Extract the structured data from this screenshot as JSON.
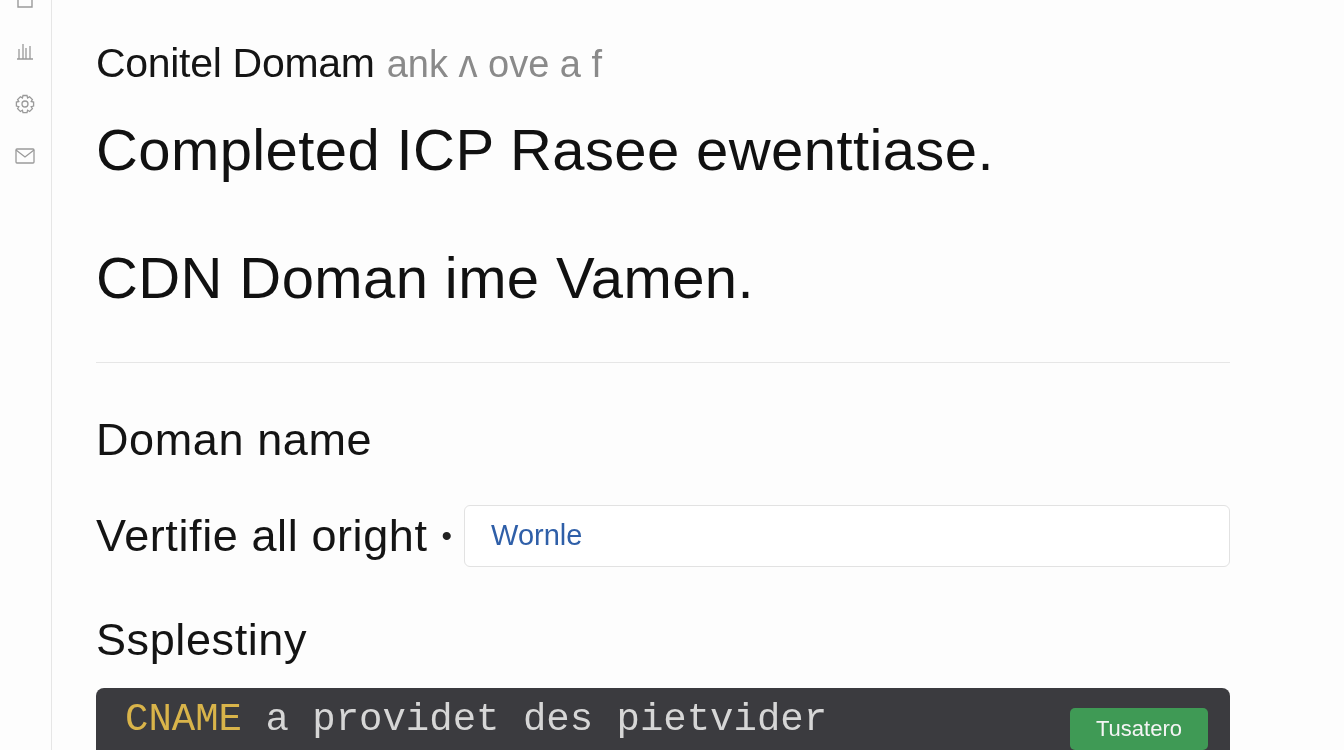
{
  "breadcrumb": {
    "title": "Conitel Domam",
    "subtitle": "ank ʌ ove a f"
  },
  "headings": [
    "Completed ICP Rasee ewenttiase.",
    "CDN Doman ime Vamen."
  ],
  "form": {
    "section_title": "Doman name",
    "field": {
      "label": "Vertifie all oright",
      "required_mark": "•",
      "value": "Wornle"
    },
    "section_2_title": "Ssplestiny",
    "code": {
      "keyword": "CNAME",
      "text": "a providet des pietvider",
      "button": "Tusatero"
    }
  }
}
